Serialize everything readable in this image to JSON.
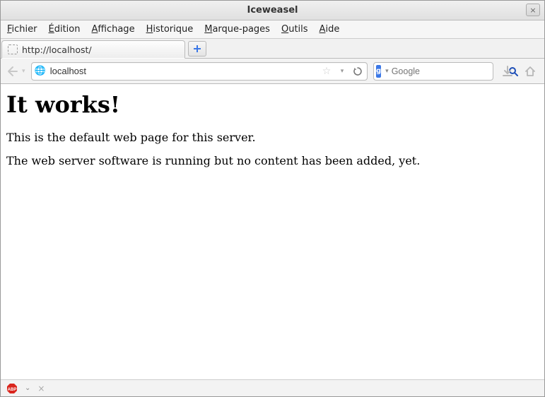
{
  "window": {
    "title": "Iceweasel"
  },
  "menubar": {
    "items": [
      {
        "label": "Fichier",
        "accel_index": 0
      },
      {
        "label": "Édition",
        "accel_index": 0
      },
      {
        "label": "Affichage",
        "accel_index": 0
      },
      {
        "label": "Historique",
        "accel_index": 0
      },
      {
        "label": "Marque-pages",
        "accel_index": 0
      },
      {
        "label": "Outils",
        "accel_index": 0
      },
      {
        "label": "Aide",
        "accel_index": 0
      }
    ]
  },
  "tabs": {
    "active": {
      "label": "http://localhost/"
    }
  },
  "urlbar": {
    "value": "localhost"
  },
  "search": {
    "engine": "g",
    "placeholder": "Google"
  },
  "page": {
    "heading": "It works!",
    "p1": "This is the default web page for this server.",
    "p2": "The web server software is running but no content has been added, yet."
  },
  "icons": {
    "close": "×",
    "plus": "+",
    "star": "☆",
    "dropdown": "▾",
    "reload": "⟳",
    "download": "⬇",
    "home": "⌂",
    "search": "🔍",
    "globe": "🌐",
    "back": "◁",
    "chev_down_small": "⌄"
  },
  "statusbar": {
    "abp": "ABP"
  }
}
